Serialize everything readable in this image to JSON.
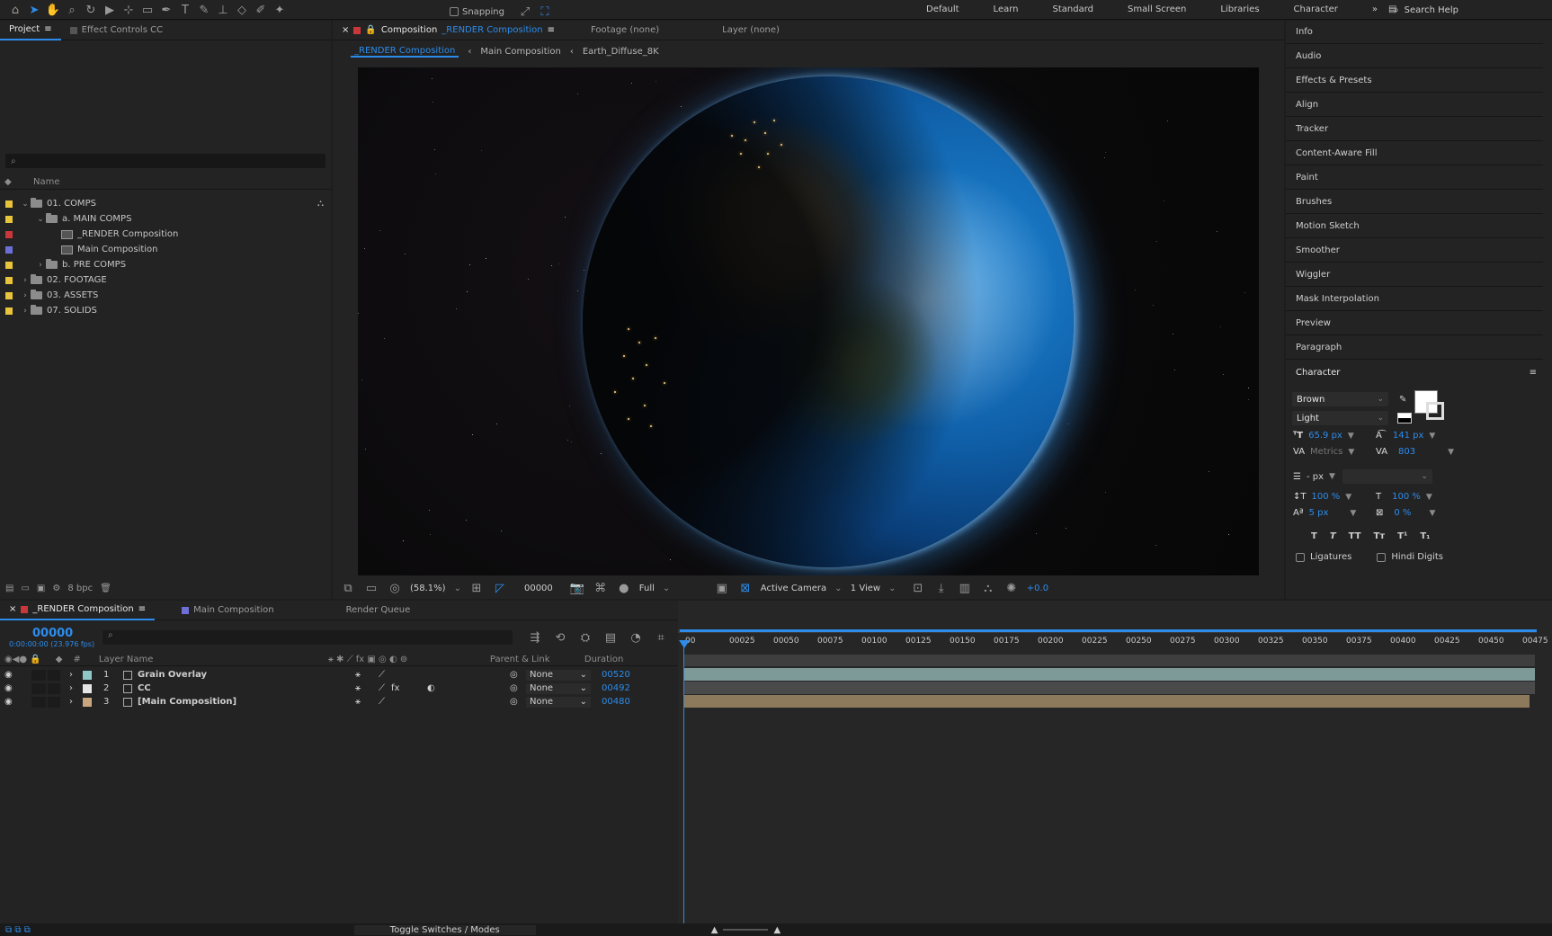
{
  "toolbar": {
    "snapping_label": "Snapping",
    "workspaces": [
      "Default",
      "Learn",
      "Standard",
      "Small Screen",
      "Libraries",
      "Character"
    ],
    "search_help": "Search Help"
  },
  "project": {
    "tab_project": "Project",
    "tab_effect_controls": "Effect Controls CC",
    "column_name": "Name",
    "items": [
      {
        "label": "01. COMPS",
        "color": "#e8c43a",
        "kind": "folder",
        "indent": 0,
        "open": true
      },
      {
        "label": "a. MAIN COMPS",
        "color": "#e8c43a",
        "kind": "folder",
        "indent": 1,
        "open": true
      },
      {
        "label": "_RENDER Composition",
        "color": "#c9373b",
        "kind": "comp",
        "indent": 2
      },
      {
        "label": "Main Composition",
        "color": "#6d6fd6",
        "kind": "comp",
        "indent": 2
      },
      {
        "label": "b. PRE COMPS",
        "color": "#e8c43a",
        "kind": "folder",
        "indent": 1,
        "open": false
      },
      {
        "label": "02. FOOTAGE",
        "color": "#e8c43a",
        "kind": "folder",
        "indent": 0,
        "open": false
      },
      {
        "label": "03. ASSETS",
        "color": "#e8c43a",
        "kind": "folder",
        "indent": 0,
        "open": false
      },
      {
        "label": "07. SOLIDS",
        "color": "#e8c43a",
        "kind": "folder",
        "indent": 0,
        "open": false
      }
    ],
    "bpc": "8 bpc"
  },
  "composition": {
    "tab_prefix": "Composition",
    "tab_name": "_RENDER Composition",
    "tab_footage": "Footage (none)",
    "tab_layer": "Layer (none)",
    "breadcrumbs": [
      "_RENDER Composition",
      "Main Composition",
      "Earth_Diffuse_8K"
    ],
    "zoom": "(58.1%)",
    "timecode": "00000",
    "resolution": "Full",
    "camera": "Active Camera",
    "views": "1 View",
    "exposure": "+0.0"
  },
  "right_panels": [
    "Info",
    "Audio",
    "Effects & Presets",
    "Align",
    "Tracker",
    "Content-Aware Fill",
    "Paint",
    "Brushes",
    "Motion Sketch",
    "Smoother",
    "Wiggler",
    "Mask Interpolation",
    "Preview",
    "Paragraph"
  ],
  "character": {
    "title": "Character",
    "font_family": "Brown",
    "font_style": "Light",
    "font_size": "65.9 px",
    "leading": "141 px",
    "kerning": "Metrics",
    "tracking": "803",
    "stroke_width": "- px",
    "vert_scale": "100 %",
    "horiz_scale": "100 %",
    "baseline_shift": "5 px",
    "tsume": "0 %",
    "ligatures_label": "Ligatures",
    "hindi_digits_label": "Hindi Digits",
    "fill_color": "#ffffff"
  },
  "timeline": {
    "tab_render": "_RENDER Composition",
    "tab_main": "Main Composition",
    "tab_queue": "Render Queue",
    "current_time": "00000",
    "fps_text": "0:00:00:00 (23.976 fps)",
    "col_layer_name": "Layer Name",
    "col_parent": "Parent & Link",
    "col_duration": "Duration",
    "ruler": [
      "00",
      "00025",
      "00050",
      "00075",
      "00100",
      "00125",
      "00150",
      "00175",
      "00200",
      "00225",
      "00250",
      "00275",
      "00300",
      "00325",
      "00350",
      "00375",
      "00400",
      "00425",
      "00450",
      "00475"
    ],
    "layers": [
      {
        "num": "1",
        "name": "Grain Overlay",
        "color": "#8fc7c9",
        "parent": "None",
        "duration": "00520",
        "bar_color": "#7d9a99"
      },
      {
        "num": "2",
        "name": "CC",
        "color": "#e6e6e6",
        "parent": "None",
        "duration": "00492",
        "bar_color": "#4a4a4a"
      },
      {
        "num": "3",
        "name": "[Main Composition]",
        "color": "#c8a77e",
        "parent": "None",
        "duration": "00480",
        "bar_color": "#8d7a5c"
      }
    ],
    "toggle_label": "Toggle Switches / Modes"
  }
}
